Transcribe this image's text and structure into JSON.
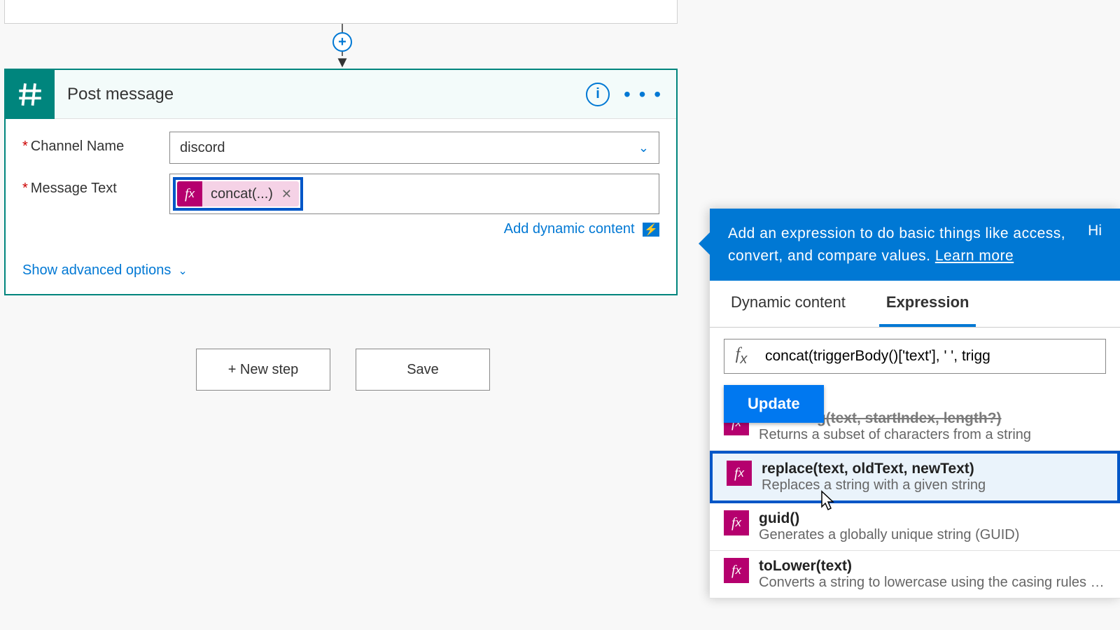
{
  "card": {
    "title": "Post message",
    "fields": {
      "channel_label": "Channel Name",
      "channel_value": "discord",
      "message_label": "Message Text",
      "token_label": "concat(...)"
    },
    "add_dynamic": "Add dynamic content",
    "advanced": "Show advanced options"
  },
  "buttons": {
    "new_step": "+ New step",
    "save": "Save"
  },
  "flyout": {
    "header_text": "Add an expression to do basic things like access, convert, and compare values.",
    "learn_more": "Learn more",
    "hide": "Hi",
    "tabs": {
      "dynamic": "Dynamic content",
      "expression": "Expression"
    },
    "expression_value": "concat(triggerBody()['text'], ' ', trigg",
    "update": "Update",
    "functions": [
      {
        "name": "substring(text, startIndex, length?)",
        "desc": "Returns a subset of characters from a string",
        "partial": true
      },
      {
        "name": "replace(text, oldText, newText)",
        "desc": "Replaces a string with a given string",
        "highlighted": true
      },
      {
        "name": "guid()",
        "desc": "Generates a globally unique string (GUID)"
      },
      {
        "name": "toLower(text)",
        "desc": "Converts a string to lowercase using the casing rules of t..."
      }
    ]
  }
}
